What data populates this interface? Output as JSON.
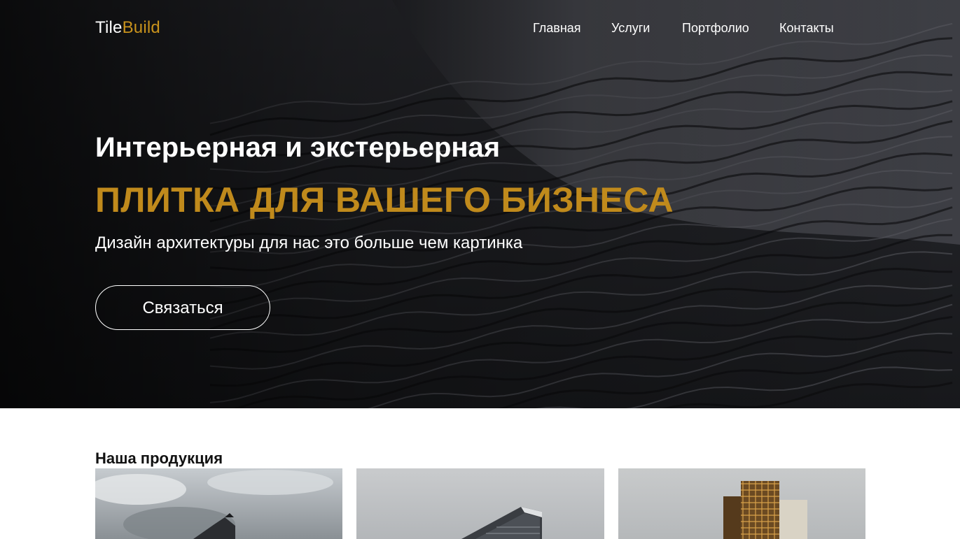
{
  "header": {
    "logo": {
      "part1": "Tile",
      "part2": "Build"
    },
    "nav": [
      {
        "label": "Главная"
      },
      {
        "label": "Услуги"
      },
      {
        "label": "Портфолио"
      },
      {
        "label": "Контакты"
      }
    ]
  },
  "hero": {
    "line1": "Интерьерная и экстерьерная",
    "line2": "ПЛИТКА ДЛЯ ВАШЕГО БИЗНЕСА",
    "line3": "Дизайн архитектуры для нас это больше чем картинка",
    "button_label": "Связаться",
    "background_image": "architecture-facade-image"
  },
  "products": {
    "title": "Наша продукция",
    "cards": [
      {
        "image": "building-cloudy-sky-image"
      },
      {
        "image": "glass-building-image"
      },
      {
        "image": "golden-tower-image"
      }
    ]
  },
  "colors": {
    "accent": "#c08a1c",
    "hero_dark": "#1b1c20",
    "text_light": "#ffffff",
    "text_dark": "#111111"
  }
}
